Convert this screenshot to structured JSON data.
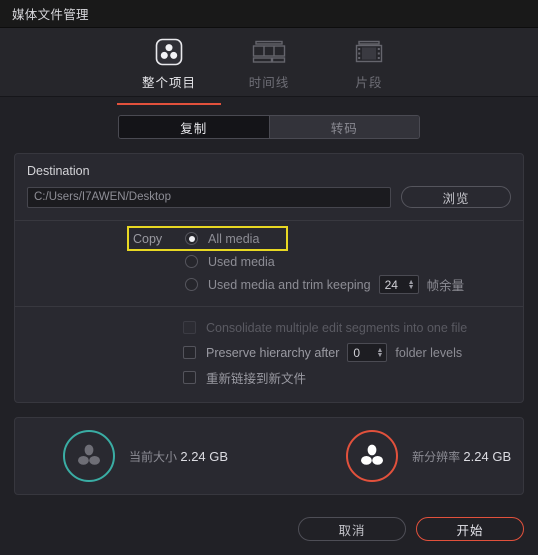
{
  "window": {
    "title": "媒体文件管理"
  },
  "accent": {
    "red": "#e2513c",
    "teal": "#3aada4",
    "highlight_yellow": "#e8d823"
  },
  "tabs": [
    {
      "label": "整个项目",
      "icon": "resolve-logo-icon",
      "active": true
    },
    {
      "label": "时间线",
      "icon": "timeline-icon",
      "active": false
    },
    {
      "label": "片段",
      "icon": "film-strip-icon",
      "active": false
    }
  ],
  "mode_segment": {
    "options": [
      "复制",
      "转码"
    ],
    "selected": "复制"
  },
  "destination": {
    "label": "Destination",
    "path_value": "C:/Users/I7AWEN/Desktop",
    "path_placeholder": "C:/Users/I7AWEN/Desktop",
    "browse_label": "浏览"
  },
  "copy_options": {
    "lead_label": "Copy",
    "selected": "All media",
    "items": [
      {
        "label": "All media",
        "checked": true,
        "highlighted": true
      },
      {
        "label": "Used media",
        "checked": false,
        "highlighted": false
      },
      {
        "label": "Used media and trim keeping",
        "checked": false,
        "highlighted": false
      }
    ],
    "handles_spinner": {
      "value": "24",
      "suffix_label": "帧余量"
    }
  },
  "checkboxes": [
    {
      "label": "Consolidate multiple edit segments into one file",
      "checked": false,
      "enabled": false
    },
    {
      "label": "Preserve hierarchy after",
      "checked": false,
      "enabled": true,
      "spinner_value": "0",
      "suffix_label": "folder levels"
    },
    {
      "label": "重新链接到新文件",
      "checked": false,
      "enabled": true
    }
  ],
  "stats": [
    {
      "name": "当前大小",
      "value": "2.24 GB",
      "ring_color": "#3aada4",
      "logo_fill": "#6e6e76"
    },
    {
      "name": "新分辨率",
      "value": "2.24 GB",
      "ring_color": "#e2513c",
      "logo_fill": "#ffffff"
    }
  ],
  "footer": {
    "cancel_label": "取消",
    "start_label": "开始"
  }
}
